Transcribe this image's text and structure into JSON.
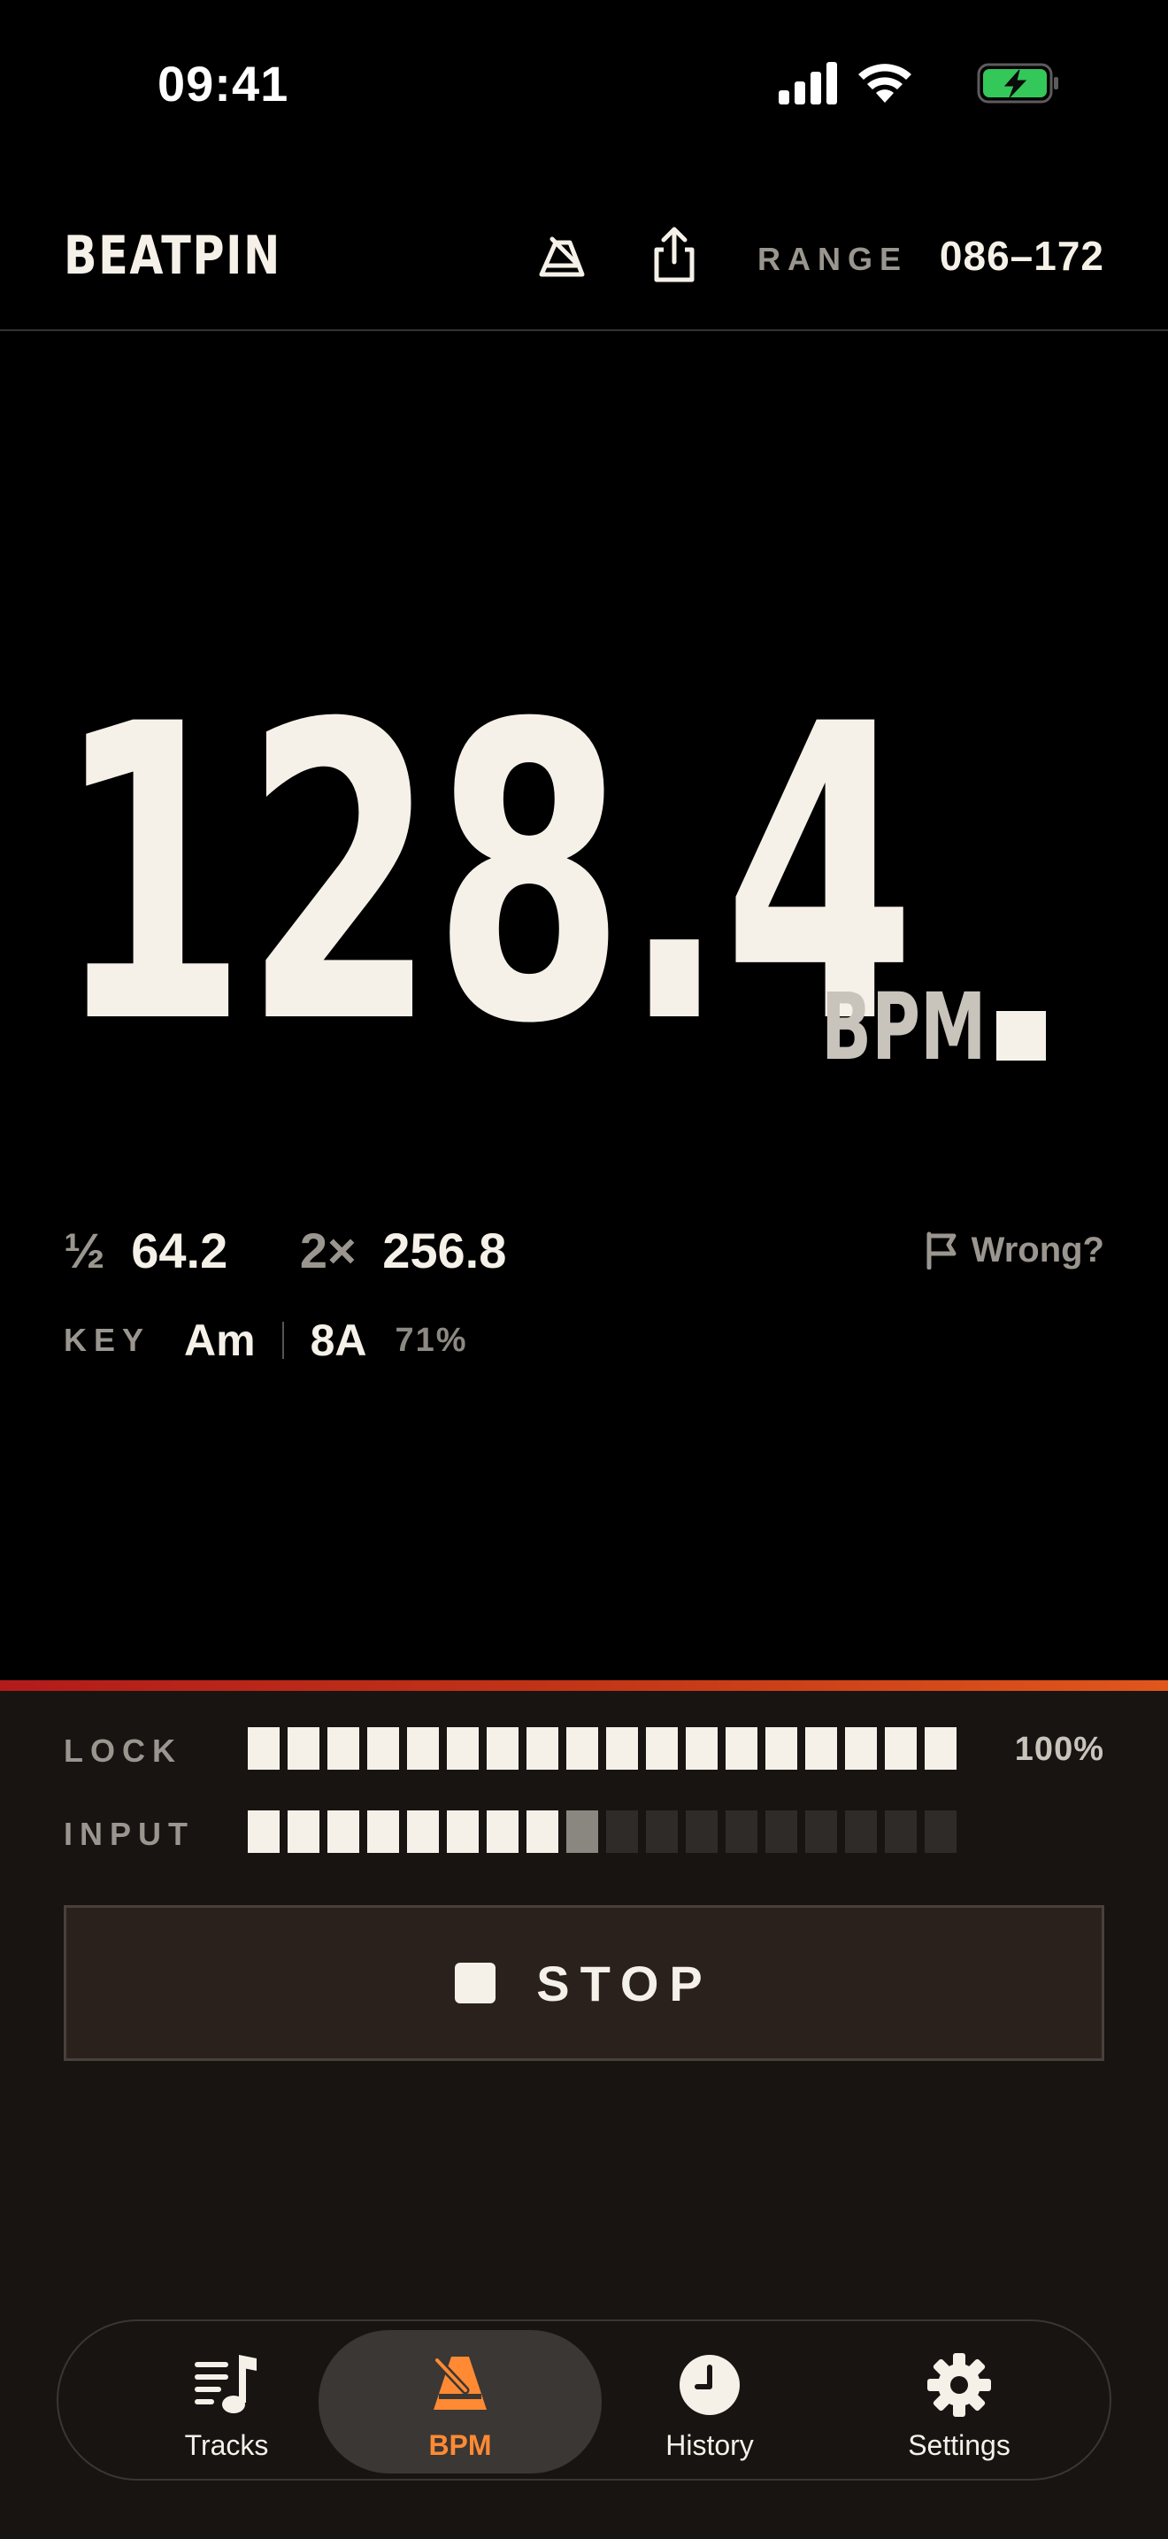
{
  "status_bar": {
    "time": "09:41"
  },
  "header": {
    "logo": "BEATPIN",
    "range_label": "RANGE",
    "range_value": "086–172"
  },
  "tempo": {
    "bpm": "128.4",
    "unit": "BPM",
    "half_glyph": "½",
    "half_value": "64.2",
    "double_glyph": "2×",
    "double_value": "256.8",
    "wrong_label": "Wrong?"
  },
  "key": {
    "label": "KEY",
    "value": "Am",
    "camelot": "8A",
    "confidence": "71%"
  },
  "meters": {
    "lock": {
      "label": "LOCK",
      "percent": "100%",
      "segments_total": 18,
      "segments_lit": 18,
      "segments_dim": 0
    },
    "input": {
      "label": "INPUT",
      "segments_total": 18,
      "segments_lit": 8,
      "segments_dim": 1
    }
  },
  "controls": {
    "stop_label": "STOP"
  },
  "tabs": [
    {
      "label": "Tracks",
      "icon": "music-list-icon",
      "active": false
    },
    {
      "label": "BPM",
      "icon": "metronome-icon",
      "active": true
    },
    {
      "label": "History",
      "icon": "clock-icon",
      "active": false
    },
    {
      "label": "Settings",
      "icon": "gear-icon",
      "active": false
    }
  ],
  "colors": {
    "background": "#000000",
    "panel": "#171412",
    "text": "#f5f1e8",
    "muted": "#9a968f",
    "accent": "#ff8a33",
    "accent_line_start": "#b31b1b",
    "accent_line_end": "#e0561c",
    "battery": "#34c759"
  }
}
